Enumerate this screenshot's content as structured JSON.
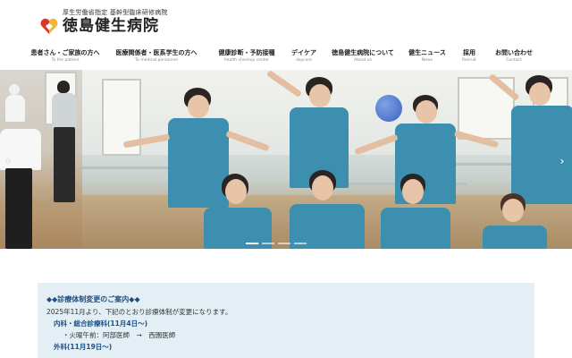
{
  "header": {
    "logo_sub": "厚生労働省指定 基幹型臨床研修病院",
    "logo_title": "徳島健生病院",
    "logo_colors": {
      "red": "#d9382a",
      "yellow": "#f2b632"
    }
  },
  "nav": {
    "items": [
      {
        "jp": "患者さん・ご家族の方へ",
        "en": "To the patient"
      },
      {
        "jp": "医療関係者・医系学生の方へ",
        "en": "To medical personnel"
      },
      {
        "jp": "健康診断・予防接種",
        "en": "health checkup center"
      },
      {
        "jp": "デイケア",
        "en": "daycare"
      },
      {
        "jp": "徳島健生病院について",
        "en": "About us"
      },
      {
        "jp": "健生ニュース",
        "en": "News"
      },
      {
        "jp": "採用",
        "en": "Recruit"
      },
      {
        "jp": "お問い合わせ",
        "en": "Contact"
      }
    ]
  },
  "hero": {
    "prev_arrow": "‹",
    "next_arrow": "›",
    "slide_count": 4,
    "active_slide": 1
  },
  "notice": {
    "title": "◆◆診療体制変更のご案内◆◆",
    "intro": "2025年11月より、下記のとおり診療体制が変更になります。",
    "dept1": "内科・総合診療科(11月4日〜)",
    "change1": "・火曜午前：阿部医師　→　西園医師",
    "dept2": "外科(11月19日〜)"
  }
}
